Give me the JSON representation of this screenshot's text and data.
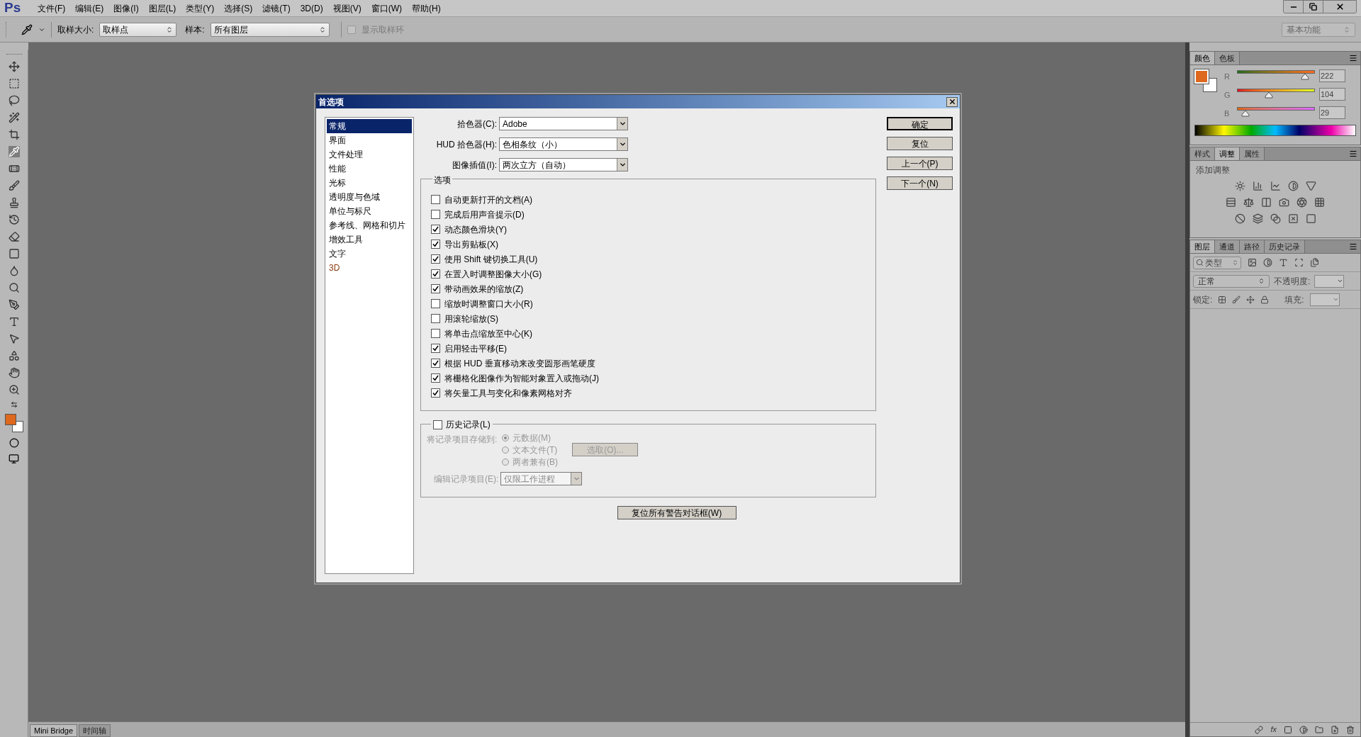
{
  "app": {
    "logo": "Ps"
  },
  "menu_bar": [
    "文件(F)",
    "编辑(E)",
    "图像(I)",
    "图层(L)",
    "类型(Y)",
    "选择(S)",
    "滤镜(T)",
    "3D(D)",
    "视图(V)",
    "窗口(W)",
    "帮助(H)"
  ],
  "options_bar": {
    "sample_size_label": "取样大小:",
    "sample_size_value": "取样点",
    "sample_label": "样本:",
    "sample_value": "所有图层",
    "show_ring": {
      "label": "显示取样环",
      "checked": false
    },
    "workspace": "基本功能"
  },
  "dialog": {
    "title": "首选项",
    "categories": [
      {
        "label": "常规",
        "selected": true
      },
      {
        "label": "界面",
        "selected": false
      },
      {
        "label": "文件处理",
        "selected": false
      },
      {
        "label": "性能",
        "selected": false
      },
      {
        "label": "光标",
        "selected": false
      },
      {
        "label": "透明度与色域",
        "selected": false
      },
      {
        "label": "单位与标尺",
        "selected": false
      },
      {
        "label": "参考线、网格和切片",
        "selected": false
      },
      {
        "label": "增效工具",
        "selected": false
      },
      {
        "label": "文字",
        "selected": false
      },
      {
        "label": "3D",
        "selected": false
      }
    ],
    "fields": [
      {
        "label": "拾色器(C):",
        "value": "Adobe"
      },
      {
        "label": "HUD 拾色器(H):",
        "value": "色相条纹（小）"
      },
      {
        "label": "图像插值(I):",
        "value": "两次立方（自动）"
      }
    ],
    "options_title": "选项",
    "options": [
      {
        "label": "自动更新打开的文档(A)",
        "checked": false
      },
      {
        "label": "完成后用声音提示(D)",
        "checked": false
      },
      {
        "label": "动态颜色滑块(Y)",
        "checked": true
      },
      {
        "label": "导出剪贴板(X)",
        "checked": true
      },
      {
        "label": "使用 Shift 键切换工具(U)",
        "checked": true
      },
      {
        "label": "在置入时调整图像大小(G)",
        "checked": true
      },
      {
        "label": "带动画效果的缩放(Z)",
        "checked": true
      },
      {
        "label": "缩放时调整窗口大小(R)",
        "checked": false
      },
      {
        "label": "用滚轮缩放(S)",
        "checked": false
      },
      {
        "label": "将单击点缩放至中心(K)",
        "checked": false
      },
      {
        "label": "启用轻击平移(E)",
        "checked": true
      },
      {
        "label": "根据 HUD 垂直移动来改变圆形画笔硬度",
        "checked": true
      },
      {
        "label": "将栅格化图像作为智能对象置入或拖动(J)",
        "checked": true
      },
      {
        "label": "将矢量工具与变化和像素网格对齐",
        "checked": true
      }
    ],
    "history": {
      "label": "历史记录(L)",
      "checked": false,
      "store_label": "将记录项目存储到:",
      "store_options": [
        {
          "label": "元数据(M)",
          "selected": true
        },
        {
          "label": "文本文件(T)",
          "selected": false
        },
        {
          "label": "两者兼有(B)",
          "selected": false
        }
      ],
      "choose_button": "选取(O)...",
      "edit_label": "编辑记录项目(E):",
      "edit_value": "仅限工作进程"
    },
    "reset_warnings_button": "复位所有警告对话框(W)",
    "buttons": [
      {
        "label": "确定",
        "default": true
      },
      {
        "label": "复位",
        "default": false
      },
      {
        "label": "上一个(P)",
        "default": false
      },
      {
        "label": "下一个(N)",
        "default": false
      }
    ]
  },
  "color_panel": {
    "tabs": [
      {
        "label": "颜色",
        "selected": true
      },
      {
        "label": "色板",
        "selected": false
      }
    ],
    "channels": [
      {
        "name": "R",
        "level": 0.87,
        "value": "222"
      },
      {
        "name": "G",
        "level": 0.41,
        "value": "104"
      },
      {
        "name": "B",
        "level": 0.11,
        "value": "29"
      }
    ]
  },
  "adjustments_panel": {
    "tabs": [
      {
        "label": "样式",
        "selected": false
      },
      {
        "label": "调整",
        "selected": true
      },
      {
        "label": "属性",
        "selected": false
      }
    ],
    "title": "添加调整"
  },
  "layers_panel": {
    "tabs": [
      {
        "label": "图层",
        "selected": true
      },
      {
        "label": "通道",
        "selected": false
      },
      {
        "label": "路径",
        "selected": false
      },
      {
        "label": "历史记录",
        "selected": false
      }
    ],
    "filter": "类型",
    "blend_mode": "正常",
    "opacity_label": "不透明度:",
    "lock_label": "锁定:",
    "fill_label": "填充:",
    "footer_fx": "fx"
  },
  "bottom_tabs": [
    {
      "label": "Mini Bridge",
      "selected": true
    },
    {
      "label": "时间轴",
      "selected": false
    }
  ]
}
